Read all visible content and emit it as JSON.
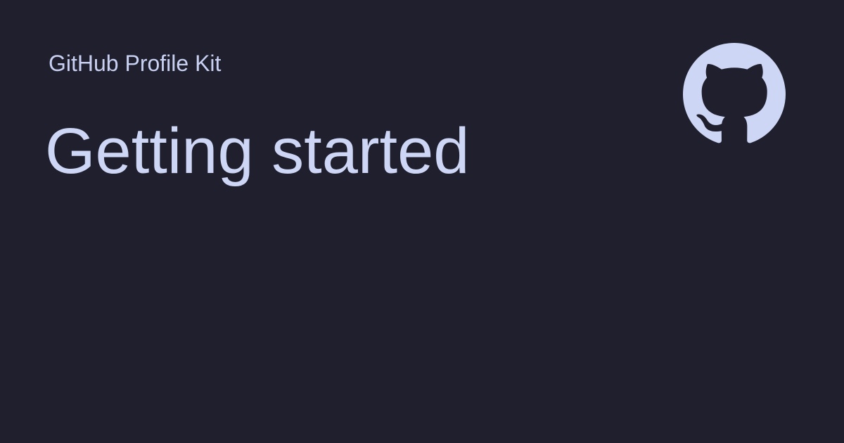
{
  "card": {
    "site_name": "GitHub Profile Kit",
    "title": "Getting started",
    "logo_icon": "github-logo-icon"
  },
  "colors": {
    "background": "#1f1f2e",
    "text": "#cdd6f4",
    "logo": "#cdd6f4"
  }
}
